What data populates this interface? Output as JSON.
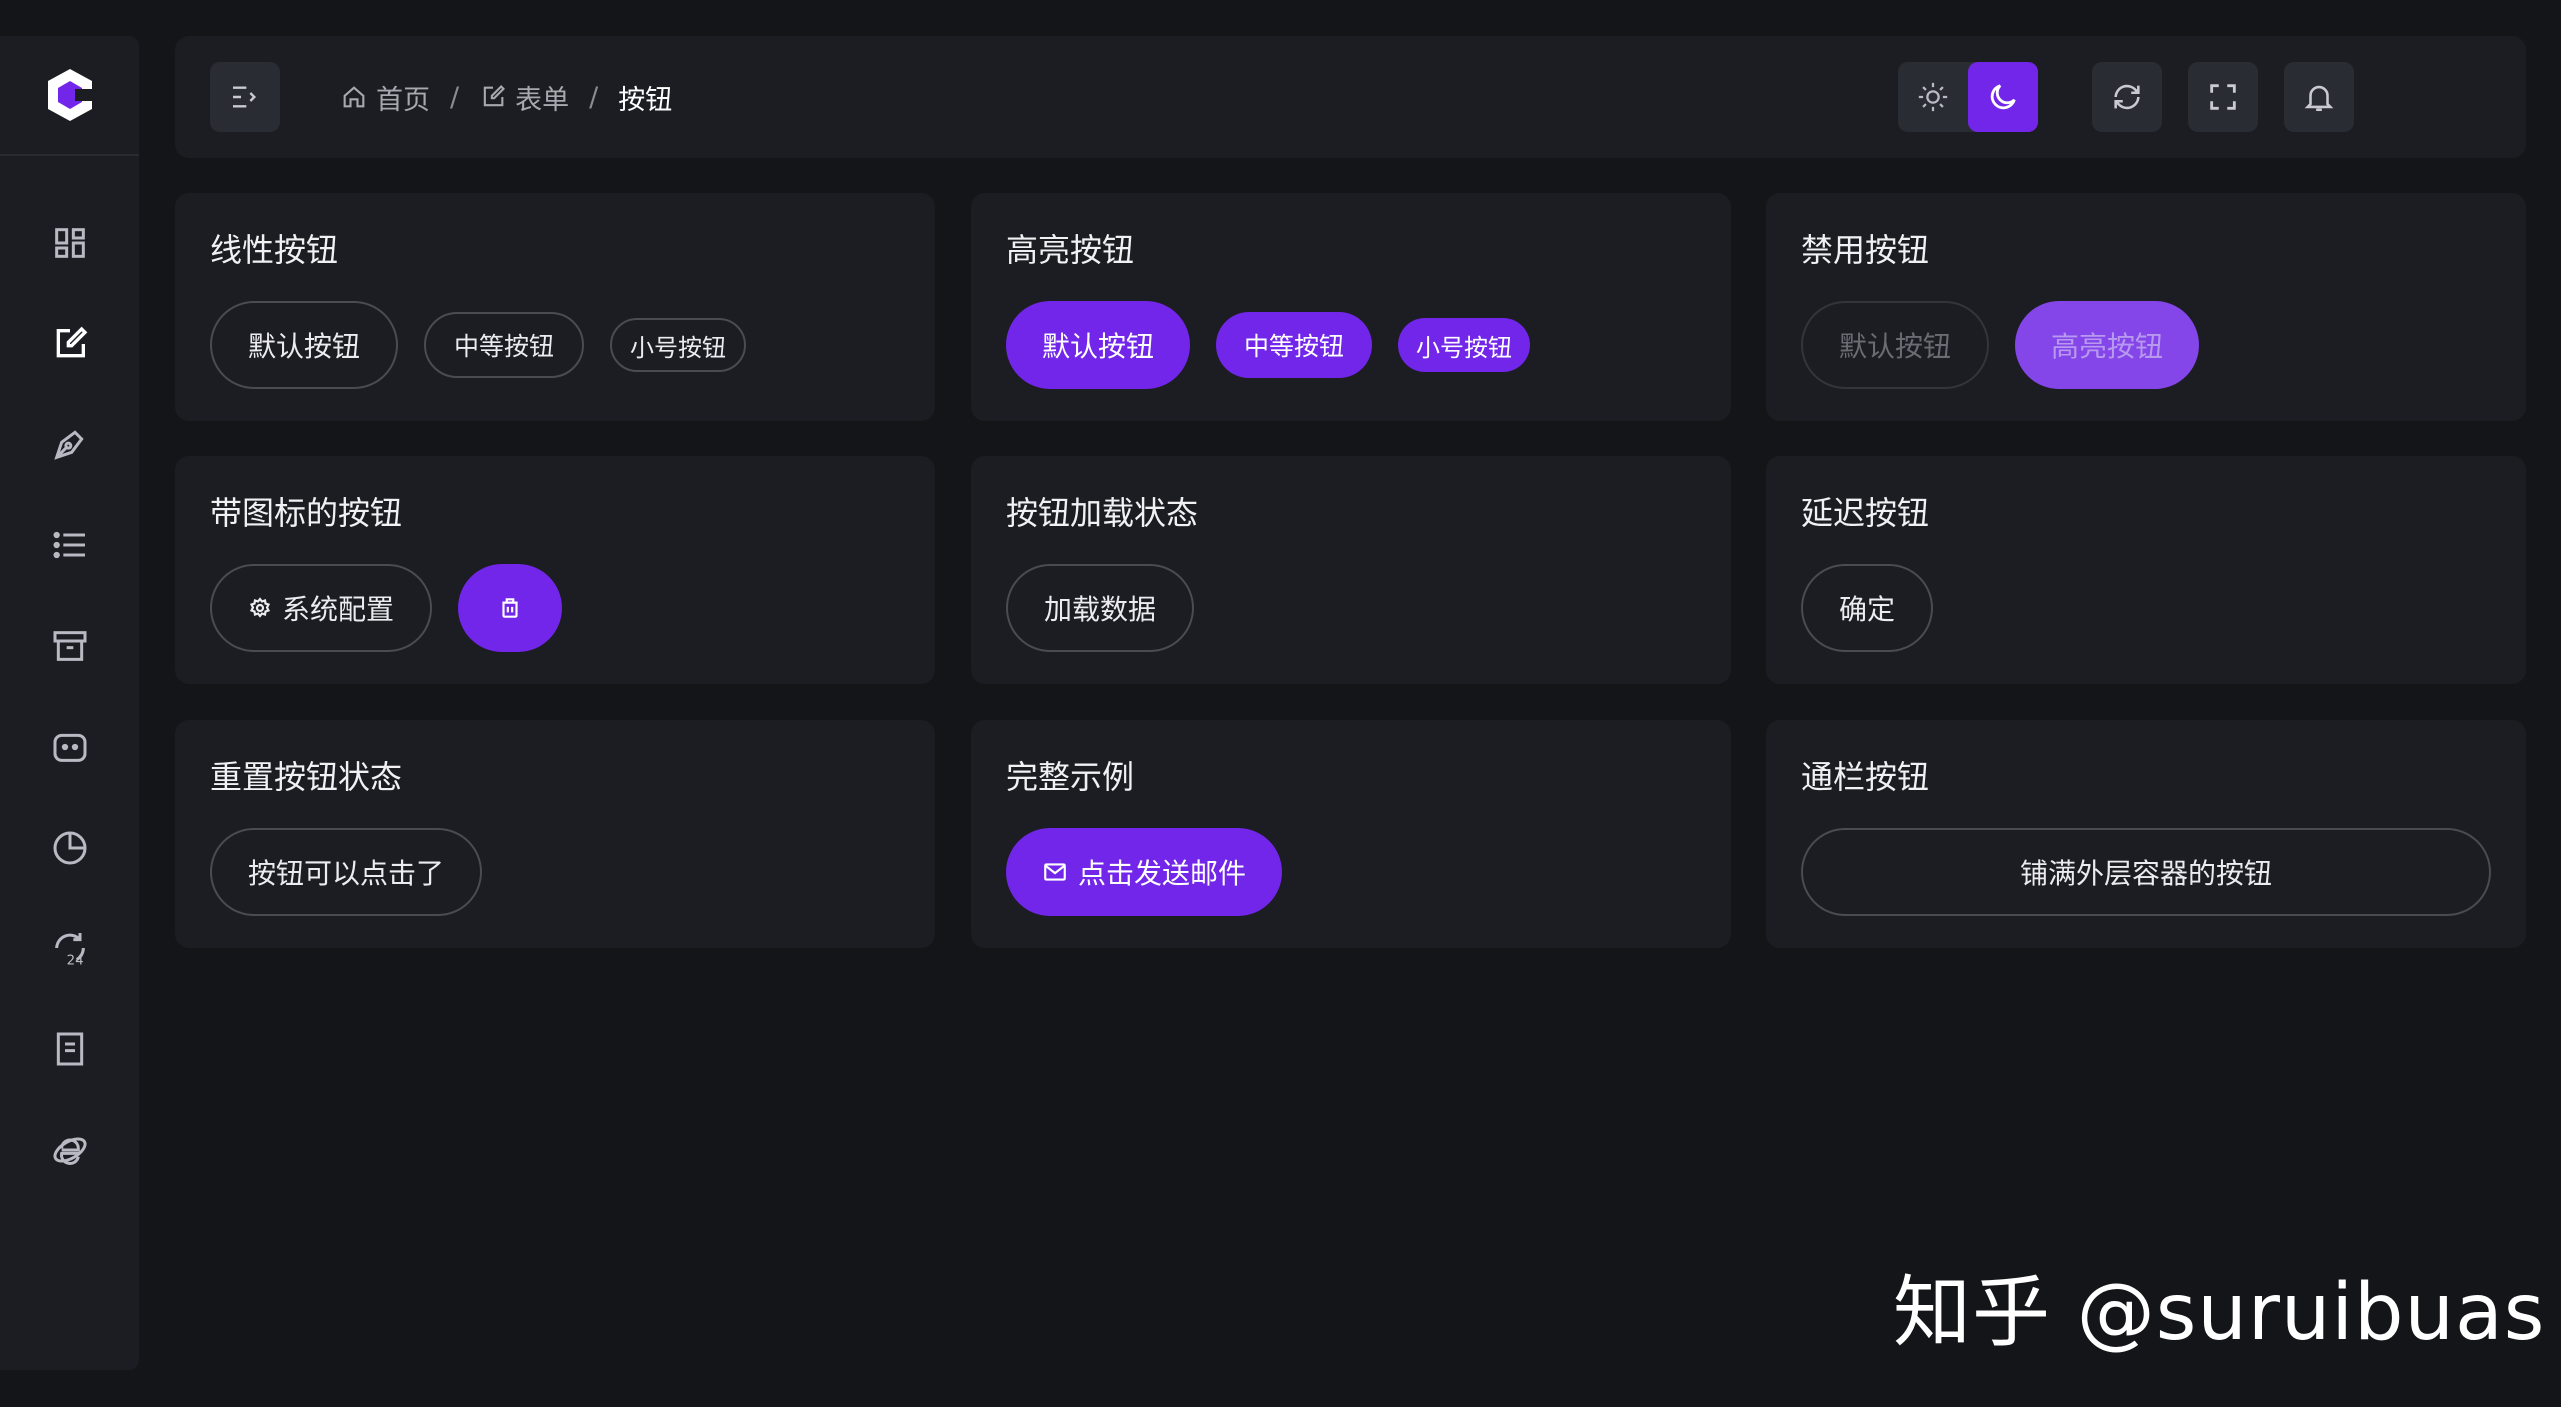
{
  "header": {
    "breadcrumb": [
      {
        "label": "首页",
        "icon": "home-icon"
      },
      {
        "label": "表单",
        "icon": "edit-icon"
      },
      {
        "label": "按钮"
      }
    ],
    "separator": "/"
  },
  "cards": {
    "line": {
      "title": "线性按钮",
      "buttons": [
        "默认按钮",
        "中等按钮",
        "小号按钮"
      ]
    },
    "highlight": {
      "title": "高亮按钮",
      "buttons": [
        "默认按钮",
        "中等按钮",
        "小号按钮"
      ]
    },
    "disabled": {
      "title": "禁用按钮",
      "buttons": [
        "默认按钮",
        "高亮按钮"
      ]
    },
    "icon": {
      "title": "带图标的按钮",
      "config_label": "系统配置"
    },
    "loading": {
      "title": "按钮加载状态",
      "button": "加载数据"
    },
    "delay": {
      "title": "延迟按钮",
      "button": "确定"
    },
    "reset": {
      "title": "重置按钮状态",
      "button": "按钮可以点击了"
    },
    "full": {
      "title": "完整示例",
      "button": "点击发送邮件"
    },
    "block": {
      "title": "通栏按钮",
      "button": "铺满外层容器的按钮"
    }
  },
  "colors": {
    "accent": "#7226ea",
    "background": "#141519",
    "card": "#1c1d22"
  },
  "watermark": "知乎 @suruibuas"
}
